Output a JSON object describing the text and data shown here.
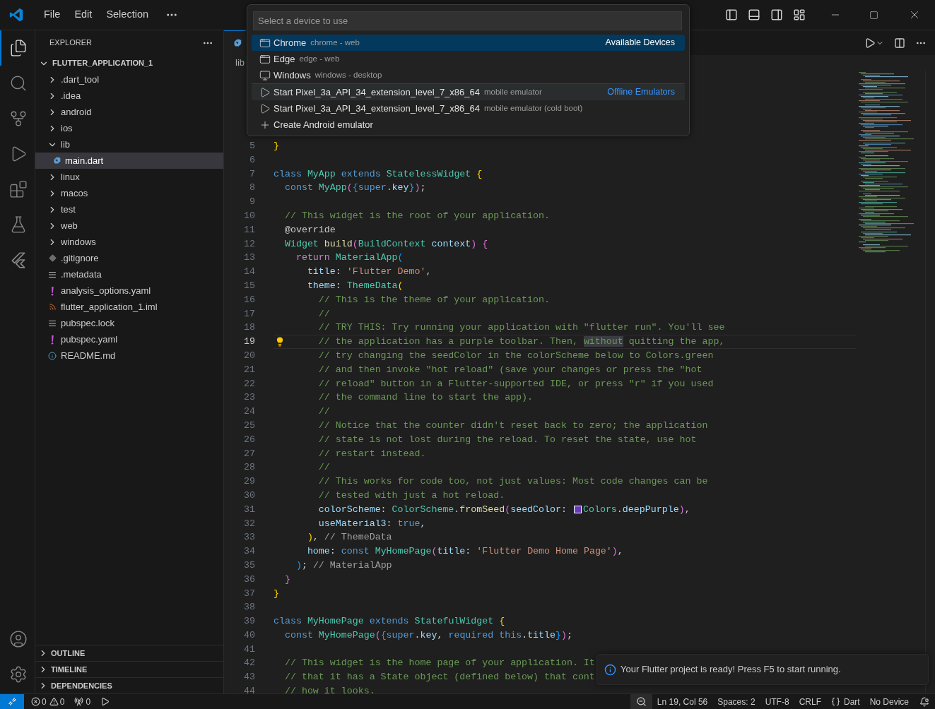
{
  "title_bar": {
    "menu": [
      "File",
      "Edit",
      "Selection"
    ]
  },
  "activity_bar": {
    "items": [
      {
        "kind": "files",
        "selected": true
      },
      {
        "kind": "search",
        "selected": false
      },
      {
        "kind": "source",
        "selected": false
      },
      {
        "kind": "run",
        "selected": false
      },
      {
        "kind": "extensions",
        "selected": false
      },
      {
        "kind": "testing",
        "selected": false
      },
      {
        "kind": "flutter",
        "selected": false
      }
    ],
    "bottom": [
      {
        "kind": "account"
      },
      {
        "kind": "settings"
      }
    ]
  },
  "explorer": {
    "title": "EXPLORER",
    "tree": [
      {
        "label": "FLUTTER_APPLICATION_1",
        "kind": "root",
        "expanded": true,
        "selected": false,
        "children": [
          {
            "label": ".dart_tool",
            "kind": "folder",
            "expanded": false,
            "selected": false
          },
          {
            "label": ".idea",
            "kind": "folder",
            "expanded": false,
            "selected": false
          },
          {
            "label": "android",
            "kind": "folder",
            "expanded": false,
            "selected": false
          },
          {
            "label": "ios",
            "kind": "folder",
            "expanded": false,
            "selected": false
          },
          {
            "label": "lib",
            "kind": "folder",
            "expanded": true,
            "selected": false,
            "children": [
              {
                "label": "main.dart",
                "kind": "dart",
                "selected": true
              }
            ]
          },
          {
            "label": "linux",
            "kind": "folder",
            "expanded": false,
            "selected": false
          },
          {
            "label": "macos",
            "kind": "folder",
            "expanded": false,
            "selected": false
          },
          {
            "label": "test",
            "kind": "folder",
            "expanded": false,
            "selected": false
          },
          {
            "label": "web",
            "kind": "folder",
            "expanded": false,
            "selected": false
          },
          {
            "label": "windows",
            "kind": "folder",
            "expanded": false,
            "selected": false
          },
          {
            "label": ".gitignore",
            "kind": "git",
            "selected": false
          },
          {
            "label": ".metadata",
            "kind": "lines",
            "selected": false
          },
          {
            "label": "analysis_options.yaml",
            "kind": "yaml",
            "selected": false
          },
          {
            "label": "flutter_application_1.iml",
            "kind": "feed",
            "selected": false
          },
          {
            "label": "pubspec.lock",
            "kind": "lines",
            "selected": false
          },
          {
            "label": "pubspec.yaml",
            "kind": "yaml",
            "selected": false
          },
          {
            "label": "README.md",
            "kind": "info",
            "selected": false
          }
        ]
      }
    ],
    "sections": [
      {
        "label": "OUTLINE",
        "expanded": false
      },
      {
        "label": "TIMELINE",
        "expanded": false
      },
      {
        "label": "DEPENDENCIES",
        "expanded": false
      }
    ]
  },
  "editor": {
    "tabs": [
      {
        "kind": "dart",
        "selected": true
      }
    ],
    "breadcrumb": [
      "lib"
    ],
    "lines": [
      {
        "number": "5",
        "tokens": [
          {
            "kind": "b1",
            "text": "}"
          }
        ]
      },
      {
        "number": "6"
      },
      {
        "number": "7",
        "tokens": [
          {
            "kind": "kw",
            "text": "class "
          },
          {
            "kind": "type",
            "text": "MyApp "
          },
          {
            "kind": "kw",
            "text": "extends "
          },
          {
            "kind": "type",
            "text": "StatelessWidget "
          },
          {
            "kind": "b1",
            "text": "{"
          }
        ]
      },
      {
        "number": "8",
        "tokens": [
          {
            "kind": "kw",
            "text": "  const "
          },
          {
            "kind": "type",
            "text": "MyApp"
          },
          {
            "kind": "b2",
            "text": "("
          },
          {
            "kind": "b3",
            "text": "{"
          },
          {
            "kind": "kw",
            "text": "super"
          },
          {
            "kind": "plain",
            "text": "."
          },
          {
            "kind": "var",
            "text": "key"
          },
          {
            "kind": "b3",
            "text": "}"
          },
          {
            "kind": "b2",
            "text": ")"
          },
          {
            "kind": "plain",
            "text": ";"
          }
        ]
      },
      {
        "number": "9"
      },
      {
        "number": "10",
        "tokens": [
          {
            "kind": "com",
            "text": "  // This widget is the root of your application."
          }
        ]
      },
      {
        "number": "11",
        "tokens": [
          {
            "kind": "plain",
            "text": "  @override"
          }
        ]
      },
      {
        "number": "12",
        "tokens": [
          {
            "kind": "type",
            "text": "  Widget "
          },
          {
            "kind": "fn",
            "text": "build"
          },
          {
            "kind": "b2",
            "text": "("
          },
          {
            "kind": "type",
            "text": "BuildContext "
          },
          {
            "kind": "var",
            "text": "context"
          },
          {
            "kind": "b2",
            "text": ") {"
          }
        ]
      },
      {
        "number": "13",
        "tokens": [
          {
            "kind": "ctrl",
            "text": "    return "
          },
          {
            "kind": "type",
            "text": "MaterialApp"
          },
          {
            "kind": "b3",
            "text": "("
          }
        ]
      },
      {
        "number": "14",
        "tokens": [
          {
            "kind": "var",
            "text": "      title"
          },
          {
            "kind": "plain",
            "text": ": "
          },
          {
            "kind": "str",
            "text": "'Flutter Demo'"
          },
          {
            "kind": "plain",
            "text": ","
          }
        ]
      },
      {
        "number": "15",
        "tokens": [
          {
            "kind": "var",
            "text": "      theme"
          },
          {
            "kind": "plain",
            "text": ": "
          },
          {
            "kind": "type",
            "text": "ThemeData"
          },
          {
            "kind": "b1",
            "text": "("
          }
        ]
      },
      {
        "number": "16",
        "tokens": [
          {
            "kind": "com",
            "text": "        // This is the theme of your application."
          }
        ]
      },
      {
        "number": "17",
        "tokens": [
          {
            "kind": "com",
            "text": "        //"
          }
        ]
      },
      {
        "number": "18",
        "tokens": [
          {
            "kind": "com",
            "text": "        // TRY THIS: Try running your application with \"flutter run\". You'll see"
          }
        ]
      },
      {
        "number": "19",
        "current": true,
        "tokens": [
          {
            "kind": "com",
            "text": "        // the application has a purple toolbar. Then, "
          },
          {
            "kind": "com",
            "text": "without",
            "highlight": true
          },
          {
            "kind": "com",
            "text": " quitting the app,"
          }
        ]
      },
      {
        "number": "20",
        "tokens": [
          {
            "kind": "com",
            "text": "        // try changing the seedColor in the colorScheme below to Colors.green"
          }
        ]
      },
      {
        "number": "21",
        "tokens": [
          {
            "kind": "com",
            "text": "        // and then invoke \"hot reload\" (save your changes or press the \"hot"
          }
        ]
      },
      {
        "number": "22",
        "tokens": [
          {
            "kind": "com",
            "text": "        // reload\" button in a Flutter-supported IDE, or press \"r\" if you used"
          }
        ]
      },
      {
        "number": "23",
        "tokens": [
          {
            "kind": "com",
            "text": "        // the command line to start the app)."
          }
        ]
      },
      {
        "number": "24",
        "tokens": [
          {
            "kind": "com",
            "text": "        //"
          }
        ]
      },
      {
        "number": "25",
        "tokens": [
          {
            "kind": "com",
            "text": "        // Notice that the counter didn't reset back to zero; the application"
          }
        ]
      },
      {
        "number": "26",
        "tokens": [
          {
            "kind": "com",
            "text": "        // state is not lost during the reload. To reset the state, use hot"
          }
        ]
      },
      {
        "number": "27",
        "tokens": [
          {
            "kind": "com",
            "text": "        // restart instead."
          }
        ]
      },
      {
        "number": "28",
        "tokens": [
          {
            "kind": "com",
            "text": "        //"
          }
        ]
      },
      {
        "number": "29",
        "tokens": [
          {
            "kind": "com",
            "text": "        // This works for code too, not just values: Most code changes can be"
          }
        ]
      },
      {
        "number": "30",
        "tokens": [
          {
            "kind": "com",
            "text": "        // tested with just a hot reload."
          }
        ]
      },
      {
        "number": "31",
        "tokens": [
          {
            "kind": "var",
            "text": "        colorScheme"
          },
          {
            "kind": "plain",
            "text": ": "
          },
          {
            "kind": "type",
            "text": "ColorScheme"
          },
          {
            "kind": "plain",
            "text": "."
          },
          {
            "kind": "fn",
            "text": "fromSeed"
          },
          {
            "kind": "b2",
            "text": "("
          },
          {
            "kind": "var",
            "text": "seedColor"
          },
          {
            "kind": "plain",
            "text": ": "
          },
          {
            "kind": "swatch",
            "color": "#673ab7"
          },
          {
            "kind": "type",
            "text": "Colors"
          },
          {
            "kind": "plain",
            "text": "."
          },
          {
            "kind": "var",
            "text": "deepPurple"
          },
          {
            "kind": "b2",
            "text": ")"
          },
          {
            "kind": "plain",
            "text": ","
          }
        ]
      },
      {
        "number": "32",
        "tokens": [
          {
            "kind": "var",
            "text": "        useMaterial3"
          },
          {
            "kind": "plain",
            "text": ": "
          },
          {
            "kind": "kw",
            "text": "true"
          },
          {
            "kind": "plain",
            "text": ","
          }
        ]
      },
      {
        "number": "33",
        "tokens": [
          {
            "kind": "b1",
            "text": "      )"
          },
          {
            "kind": "plain",
            "text": ", "
          },
          {
            "kind": "label",
            "text": "// ThemeData"
          }
        ]
      },
      {
        "number": "34",
        "tokens": [
          {
            "kind": "var",
            "text": "      home"
          },
          {
            "kind": "plain",
            "text": ": "
          },
          {
            "kind": "kw",
            "text": "const "
          },
          {
            "kind": "type",
            "text": "MyHomePage"
          },
          {
            "kind": "b2",
            "text": "("
          },
          {
            "kind": "var",
            "text": "title"
          },
          {
            "kind": "plain",
            "text": ": "
          },
          {
            "kind": "str",
            "text": "'Flutter Demo Home Page'"
          },
          {
            "kind": "b2",
            "text": ")"
          },
          {
            "kind": "plain",
            "text": ","
          }
        ]
      },
      {
        "number": "35",
        "tokens": [
          {
            "kind": "b3",
            "text": "    )"
          },
          {
            "kind": "plain",
            "text": "; "
          },
          {
            "kind": "label",
            "text": "// MaterialApp"
          }
        ]
      },
      {
        "number": "36",
        "tokens": [
          {
            "kind": "b2",
            "text": "  }"
          }
        ]
      },
      {
        "number": "37",
        "tokens": [
          {
            "kind": "b1",
            "text": "}"
          }
        ]
      },
      {
        "number": "38"
      },
      {
        "number": "39",
        "tokens": [
          {
            "kind": "kw",
            "text": "class "
          },
          {
            "kind": "type",
            "text": "MyHomePage "
          },
          {
            "kind": "kw",
            "text": "extends "
          },
          {
            "kind": "type",
            "text": "StatefulWidget "
          },
          {
            "kind": "b1",
            "text": "{"
          }
        ]
      },
      {
        "number": "40",
        "tokens": [
          {
            "kind": "kw",
            "text": "  const "
          },
          {
            "kind": "type",
            "text": "MyHomePage"
          },
          {
            "kind": "b2",
            "text": "("
          },
          {
            "kind": "b3",
            "text": "{"
          },
          {
            "kind": "kw",
            "text": "super"
          },
          {
            "kind": "plain",
            "text": "."
          },
          {
            "kind": "var",
            "text": "key"
          },
          {
            "kind": "plain",
            "text": ", "
          },
          {
            "kind": "kw",
            "text": "required this"
          },
          {
            "kind": "plain",
            "text": "."
          },
          {
            "kind": "var",
            "text": "title"
          },
          {
            "kind": "b3",
            "text": "}"
          },
          {
            "kind": "b2",
            "text": ")"
          },
          {
            "kind": "plain",
            "text": ";"
          }
        ]
      },
      {
        "number": "41"
      },
      {
        "number": "42",
        "tokens": [
          {
            "kind": "com",
            "text": "  // This widget is the home page of your application. It"
          }
        ]
      },
      {
        "number": "43",
        "tokens": [
          {
            "kind": "com",
            "text": "  // that it has a State object (defined below) that cont"
          }
        ]
      },
      {
        "number": "44",
        "tokens": [
          {
            "kind": "com",
            "text": "  // how it looks."
          }
        ]
      }
    ]
  },
  "quick_pick": {
    "placeholder": "Select a device to use",
    "groups": [
      {
        "label": "Available Devices",
        "items": [
          {
            "kind": "browser",
            "label": "Chrome",
            "description": "chrome - web",
            "selected": true,
            "hovered": false
          },
          {
            "kind": "browser",
            "label": "Edge",
            "description": "edge - web",
            "selected": false,
            "hovered": false
          },
          {
            "kind": "desktop",
            "label": "Windows",
            "description": "windows - desktop",
            "selected": false,
            "hovered": false
          }
        ]
      },
      {
        "label": "Offline Emulators",
        "items": [
          {
            "kind": "play",
            "label": "Start Pixel_3a_API_34_extension_level_7_x86_64",
            "description": "mobile emulator",
            "selected": false,
            "hovered": true
          },
          {
            "kind": "play",
            "label": "Start Pixel_3a_API_34_extension_level_7_x86_64",
            "description": "mobile emulator (cold boot)",
            "selected": false,
            "hovered": false
          },
          {
            "kind": "add",
            "label": "Create Android emulator",
            "selected": false,
            "hovered": false
          }
        ]
      }
    ]
  },
  "notification": {
    "message": "Your Flutter project is ready! Press F5 to start running."
  },
  "status_bar": {
    "errors": "0",
    "warnings": "0",
    "ports": "0",
    "right": [
      {
        "kind": "zoom"
      },
      {
        "kind": "text",
        "label": "Ln 19, Col 56"
      },
      {
        "kind": "text",
        "label": "Spaces: 2"
      },
      {
        "kind": "text",
        "label": "UTF-8"
      },
      {
        "kind": "text",
        "label": "CRLF"
      },
      {
        "kind": "language",
        "label": "Dart"
      },
      {
        "kind": "text",
        "label": "No Device"
      },
      {
        "kind": "bell"
      }
    ]
  }
}
